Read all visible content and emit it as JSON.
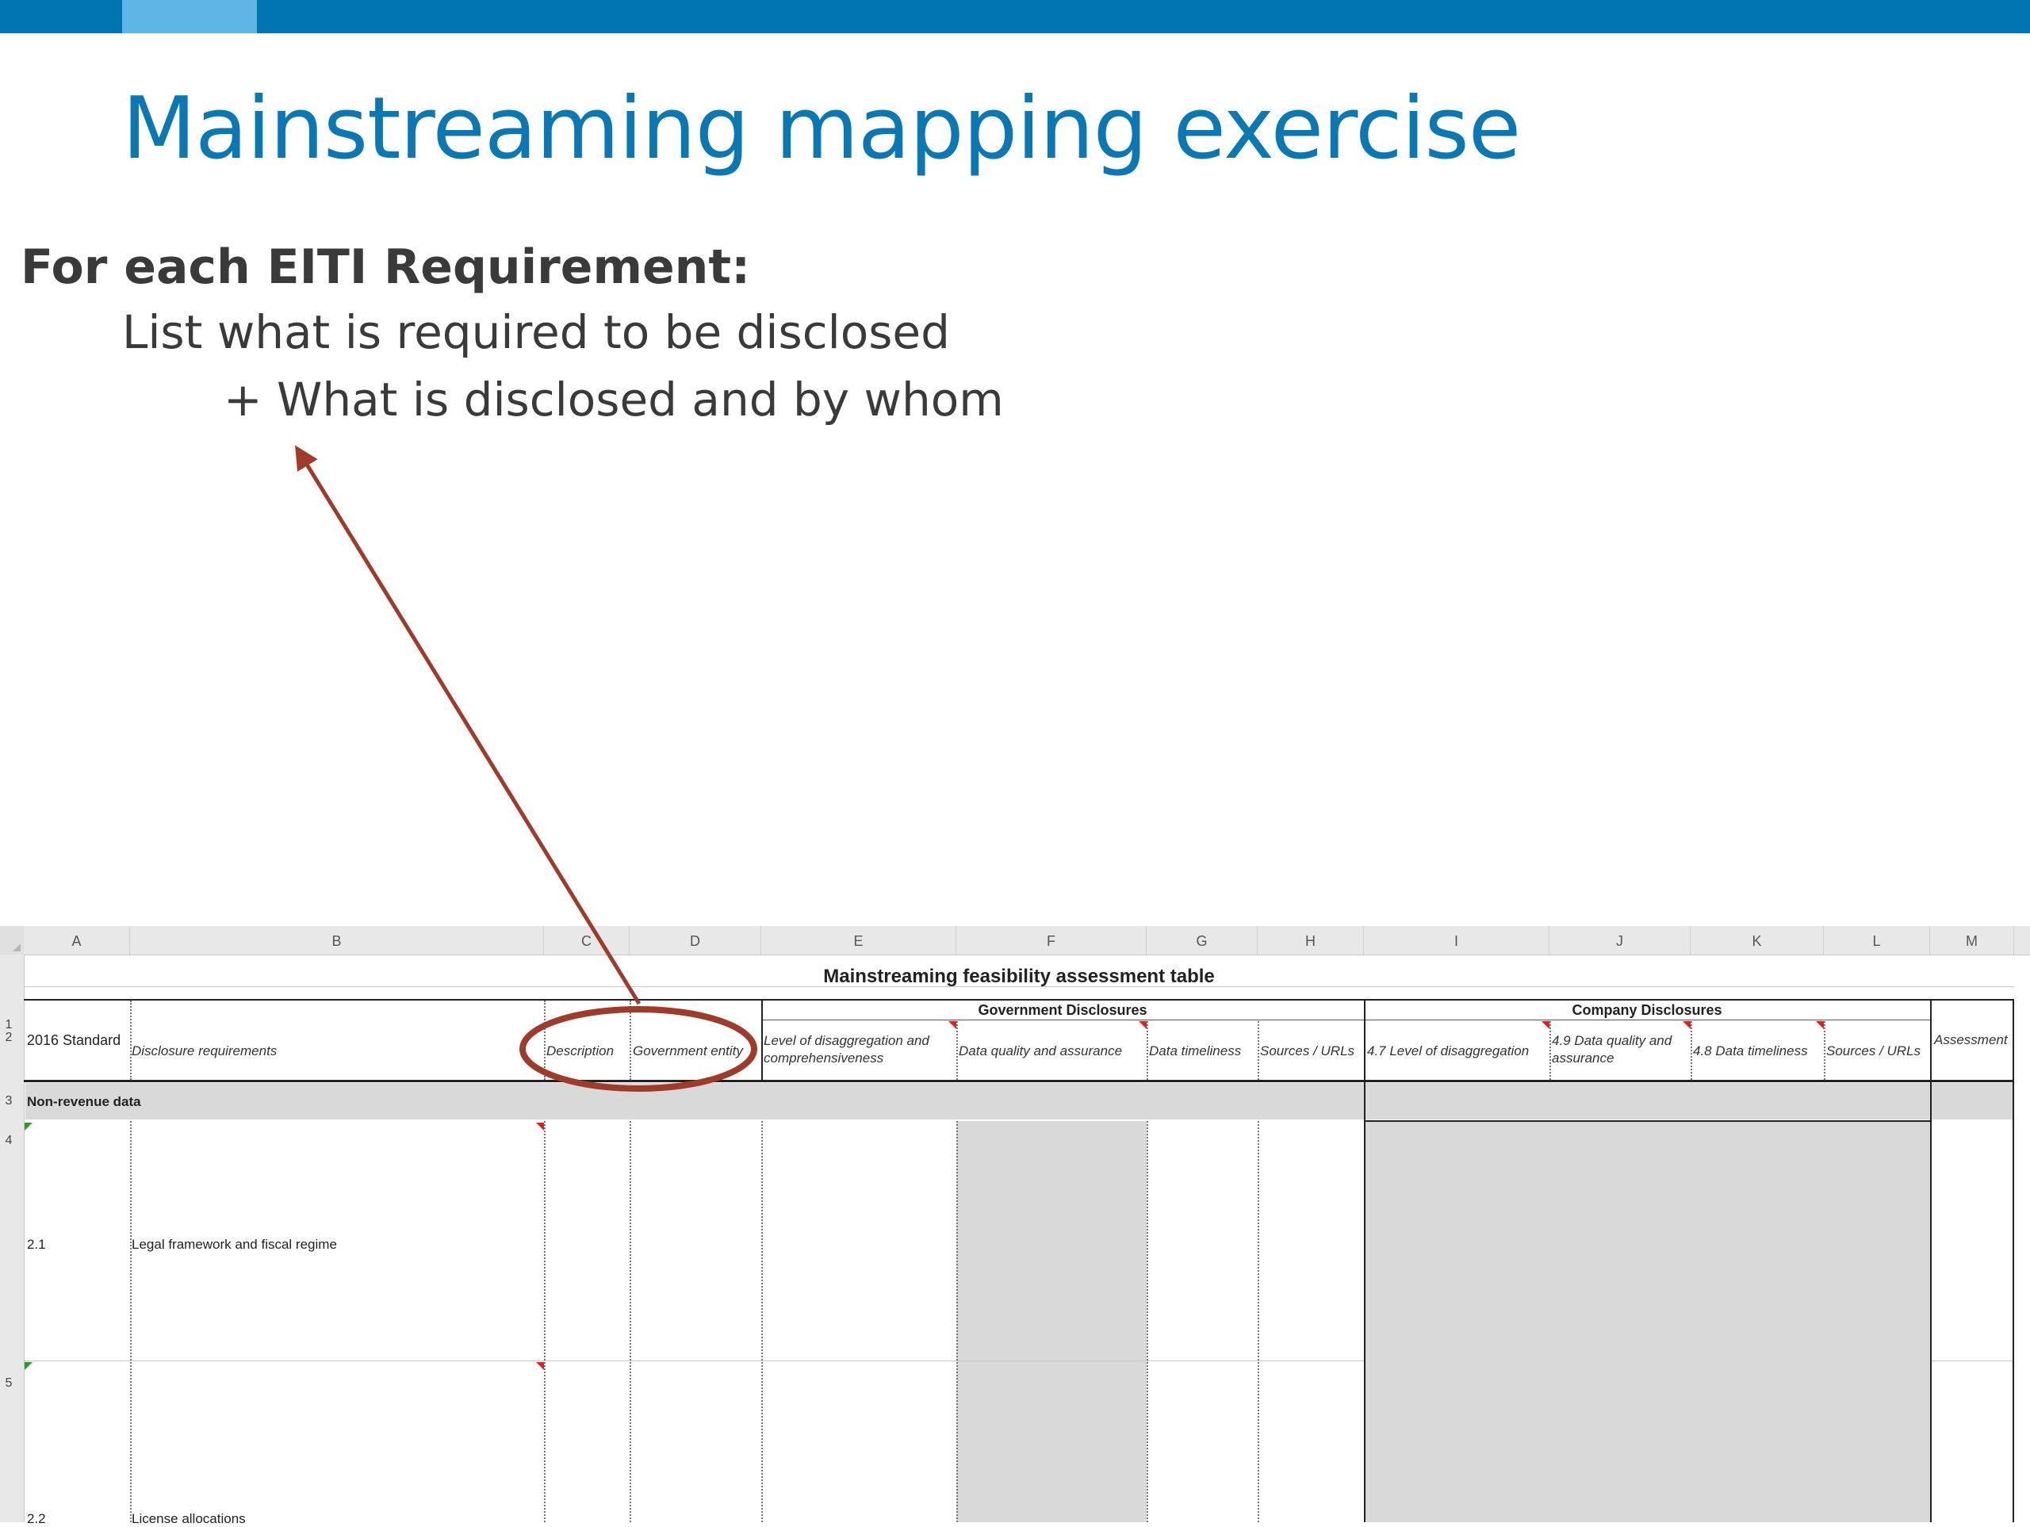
{
  "slide": {
    "title": "Mainstreaming mapping exercise",
    "heading": "For each EITI Requirement:",
    "line1": "List what is required to be disclosed",
    "line2": "+ What is disclosed and by whom"
  },
  "colors": {
    "brand_bar": "#0076b0",
    "brand_accent": "#5fb6e6",
    "title": "#0b78b4",
    "annotation": "#9e3b2a",
    "shaded_cell": "#d9d9d9"
  },
  "spreadsheet": {
    "column_letters": [
      "A",
      "B",
      "C",
      "D",
      "E",
      "F",
      "G",
      "H",
      "I",
      "J",
      "K",
      "L",
      "M"
    ],
    "row_numbers": [
      "1",
      "2",
      "3",
      "4",
      "5"
    ],
    "table_title": "Mainstreaming feasibility assessment table",
    "group_government": "Government Disclosures",
    "group_company": "Company Disclosures",
    "headers": {
      "a": "2016 Standard",
      "b": "Disclosure requirements",
      "c": "Description",
      "d": "Government entity",
      "e": "Level of disaggregation and comprehensiveness",
      "f": "Data quality and assurance",
      "g": "Data timeliness",
      "h": "Sources / URLs",
      "i": "4.7 Level of disaggregation",
      "j": "4.9 Data quality and assurance",
      "k": "4.8 Data timeliness",
      "l": "Sources / URLs",
      "m": "Assessment"
    },
    "section": "Non-revenue data",
    "rows": [
      {
        "id": "2.1",
        "requirement": "Legal framework and fiscal regime"
      },
      {
        "id": "2.2",
        "requirement": "License allocations"
      }
    ]
  }
}
